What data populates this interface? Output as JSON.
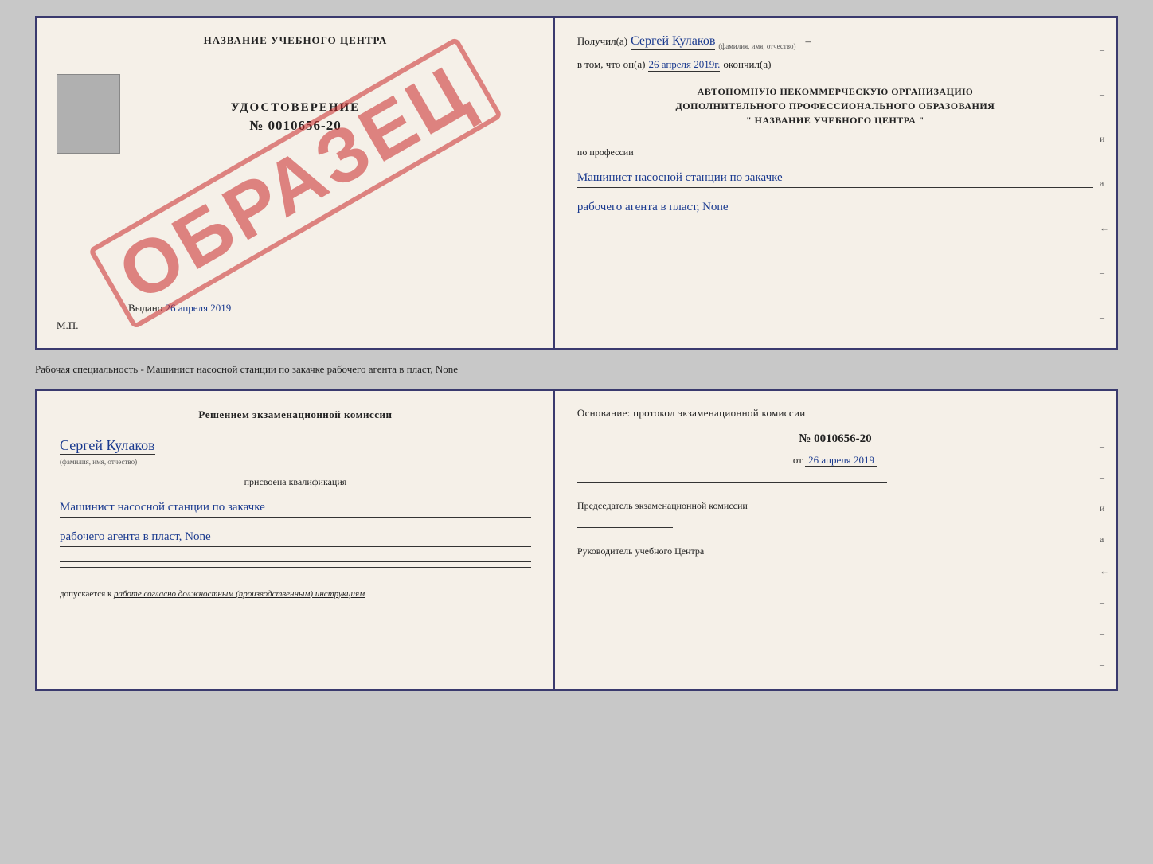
{
  "top_doc": {
    "left": {
      "title": "НАЗВАНИЕ УЧЕБНОГО ЦЕНТРА",
      "stamp": "ОБРАЗЕЦ",
      "udostoverenie": "УДОСТОВЕРЕНИЕ",
      "number": "№ 0010656-20",
      "vydano_label": "Выдано",
      "vydano_date": "26 апреля 2019",
      "mp": "М.П."
    },
    "right": {
      "poluchil_label": "Получил(а)",
      "poluchil_name": "Сергей Кулаков",
      "familiya_hint": "(фамилия, имя, отчество)",
      "dash1": "–",
      "vtom_label": "в том, что он(а)",
      "vtom_date": "26 апреля 2019г.",
      "okonchil": "окончил(а)",
      "org_line1": "АВТОНОМНУЮ НЕКОММЕРЧЕСКУЮ ОРГАНИЗАЦИЮ",
      "org_line2": "ДОПОЛНИТЕЛЬНОГО ПРОФЕССИОНАЛЬНОГО ОБРАЗОВАНИЯ",
      "org_line3": "\"  НАЗВАНИЕ УЧЕБНОГО ЦЕНТРА  \"",
      "po_professii": "по профессии",
      "profession_line1": "Машинист насосной станции по закачке",
      "profession_line2": "рабочего агента в пласт, None",
      "dashes": [
        "-",
        "-",
        "-",
        "и",
        "а",
        "←",
        "-",
        "-",
        "-"
      ]
    }
  },
  "subtitle": "Рабочая специальность - Машинист насосной станции по закачке рабочего агента в пласт, None",
  "bottom_doc": {
    "left": {
      "komissia_text": "Решением экзаменационной комиссии",
      "name": "Сергей Кулаков",
      "familiya_hint": "(фамилия, имя, отчество)",
      "prisvoyena": "присвоена квалификация",
      "qual_line1": "Машинист насосной станции по закачке",
      "qual_line2": "рабочего агента в пласт, None",
      "dopuskaetsya": "допускается к",
      "dopusk_text": "работе согласно должностным (производственным) инструкциям"
    },
    "right": {
      "osnovaniye": "Основание: протокол экзаменационной комиссии",
      "protocol_number": "№ 0010656-20",
      "ot_label": "от",
      "ot_date": "26 апреля 2019",
      "predsedatel_label": "Председатель экзаменационной комиссии",
      "rukovoditel_label": "Руководитель учебного Центра",
      "dashes": [
        "-",
        "-",
        "-",
        "и",
        "а",
        "←",
        "-",
        "-",
        "-"
      ]
    }
  }
}
